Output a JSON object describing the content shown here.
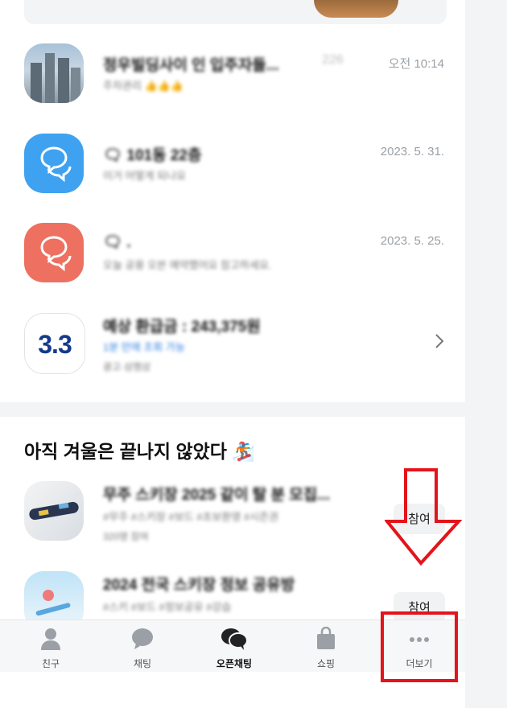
{
  "chats": [
    {
      "title": "정우빌딩사이 인 입주자들...",
      "count": "226",
      "preview": "주차관리 👍👍👍",
      "time": "오전 10:14"
    },
    {
      "title": "🗨 101동 22층",
      "count": "",
      "preview": "이거 어떻게 되나요",
      "time": "2023. 5. 31."
    },
    {
      "title": "🗨 .",
      "count": "",
      "preview": "오늘 공용 오븐 예약했어요 참고하세요.",
      "time": "2023. 5. 25."
    }
  ],
  "ad": {
    "logo_text": "3.3",
    "title": "예상 환급금 : 243,375원",
    "subtitle": "1분 만에 조회 가능",
    "sponsor": "광고·삼쩜삼",
    "chevron": "›"
  },
  "section": {
    "title": "아직 겨울은 끝나지 않았다 🏂"
  },
  "openchats": [
    {
      "title": "무주 스키장 2025 같이 탈 분 모집...",
      "desc": "#무주 #스키장 #보드 #초보환영 #시즌권",
      "meta": "320명 참여",
      "button": "참여"
    },
    {
      "title": "2024 전국 스키장 정보 공유방",
      "desc": "#스키 #보드 #정보공유 #강습",
      "meta": "",
      "button": "참여"
    }
  ],
  "tabs": [
    {
      "label": "친구",
      "icon": "person-icon"
    },
    {
      "label": "채팅",
      "icon": "chat-bubble-icon"
    },
    {
      "label": "오픈채팅",
      "icon": "open-chat-icon",
      "active": true
    },
    {
      "label": "쇼핑",
      "icon": "shopping-bag-icon"
    },
    {
      "label": "더보기",
      "icon": "more-dots-icon"
    }
  ],
  "colors": {
    "accent_red": "#e3141b",
    "chat_blue": "#3ea2f0",
    "chat_red": "#ee7060",
    "link_blue": "#2f7fe0"
  }
}
